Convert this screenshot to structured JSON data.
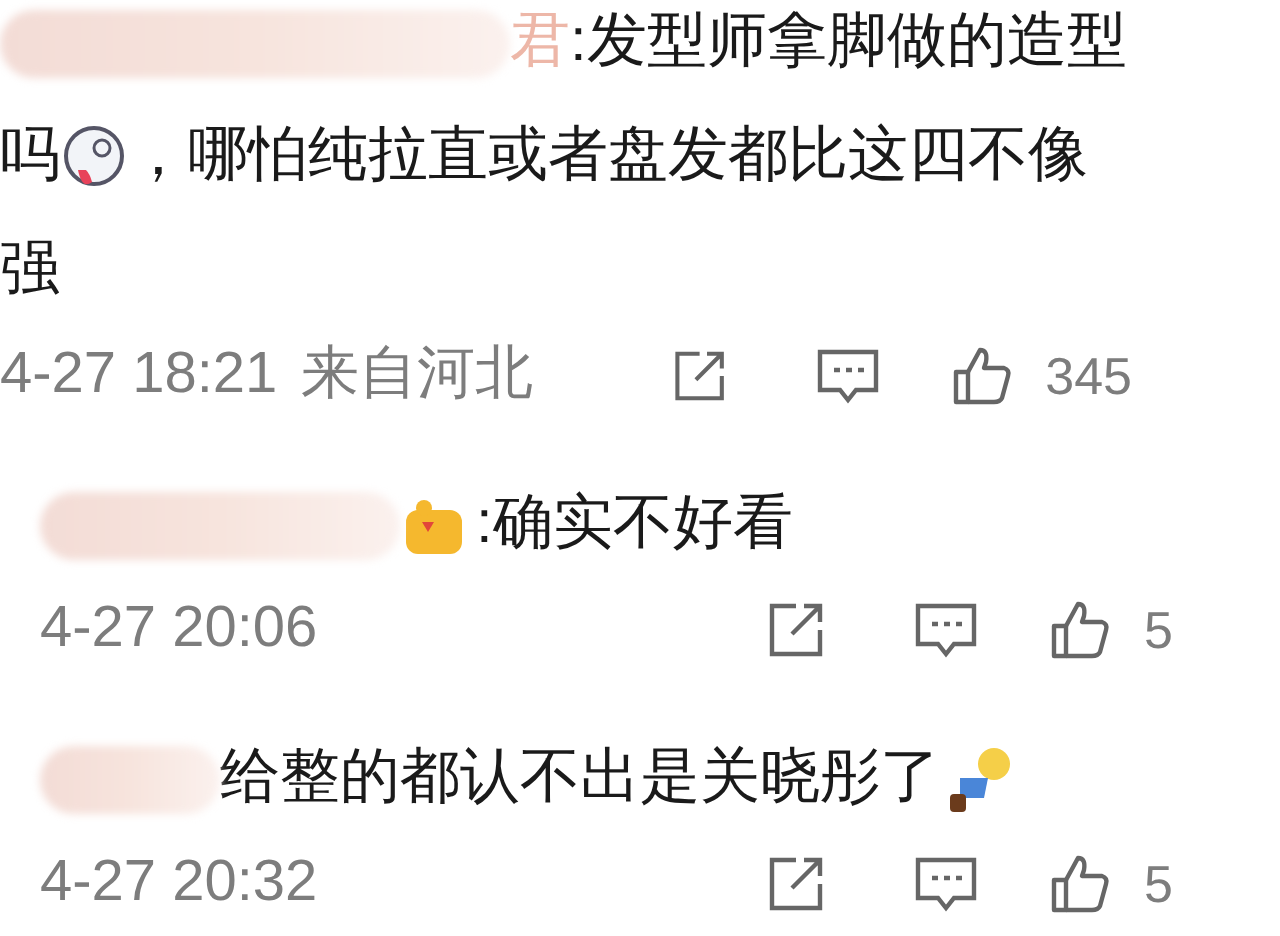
{
  "comments": [
    {
      "name_tail": "君",
      "parts": [
        {
          "kind": "text",
          "text": ":发型师拿脚做的造型"
        },
        {
          "kind": "text",
          "text": "吗"
        },
        {
          "kind": "emoji"
        },
        {
          "kind": "text",
          "text": "，哪怕纯拉直或者盘发都比这四不像"
        },
        {
          "kind": "text",
          "text": "强"
        }
      ],
      "time": "4-27 18:21",
      "location": "来自河北",
      "likes": "345"
    },
    {
      "parts": [
        {
          "kind": "badge"
        },
        {
          "kind": "text",
          "text": ":确实不好看"
        }
      ],
      "time": "4-27 20:06",
      "likes": "5"
    },
    {
      "parts": [
        {
          "kind": "text",
          "text": "给整的都认不出是关晓彤了"
        },
        {
          "kind": "figure"
        }
      ],
      "time": "4-27 20:32",
      "likes": "5"
    }
  ]
}
